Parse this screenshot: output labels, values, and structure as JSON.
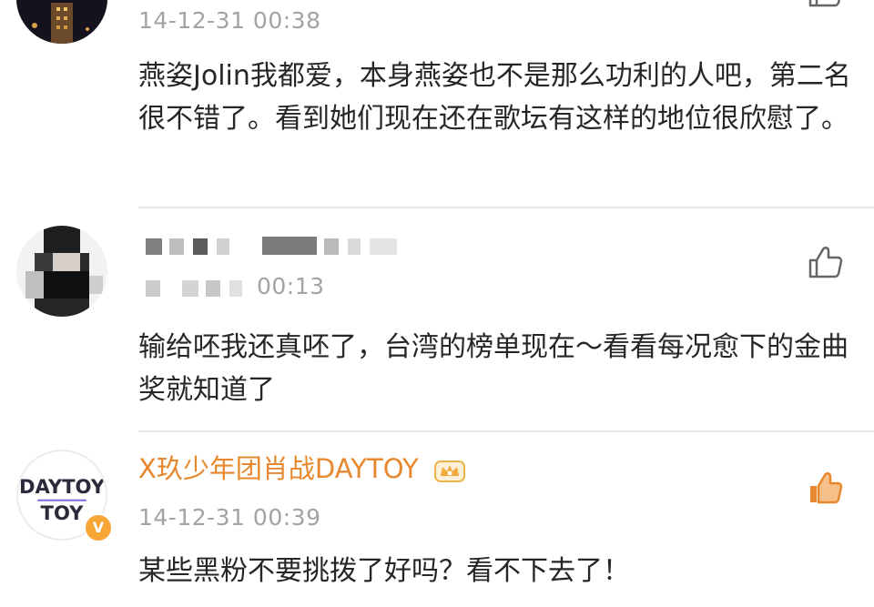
{
  "comments": [
    {
      "timestamp": "14-12-31 00:38",
      "text": "燕姿Jolin我都爱，本身燕姿也不是那么功利的人吧，第二名很不错了。看到她们现在还在歌坛有这样的地位很欣慰了。",
      "like_icon": "thumbs-up-outline-icon"
    },
    {
      "timestamp_visible_fragment": "00:13",
      "text": "输给呸我还真呸了，台湾的榜单现在～看看每况愈下的金曲奖就知道了",
      "like_icon": "thumbs-up-outline-icon"
    },
    {
      "username": "X玖少年团肖战DAYTOY",
      "timestamp": "14-12-31 00:39",
      "text": "某些黑粉不要挑拨了好吗？看不下去了！",
      "avatar_logo_text": "DAYTOY",
      "verified_mark": "V",
      "like_icon": "thumbs-up-filled-icon",
      "like_color": "#e8882e",
      "username_color": "#e8882e"
    }
  ]
}
